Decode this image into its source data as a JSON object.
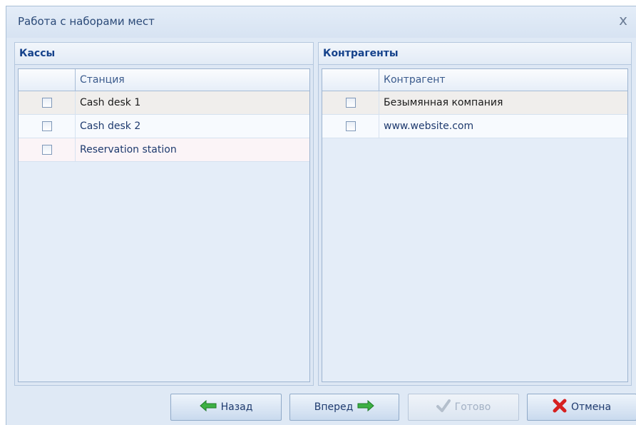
{
  "window": {
    "title": "Работа с наборами мест",
    "close_label": "x"
  },
  "left_pane": {
    "header": "Кассы",
    "column_header": "Станция",
    "rows": [
      {
        "label": "Cash desk 1",
        "checked": false
      },
      {
        "label": "Cash desk 2",
        "checked": false
      },
      {
        "label": "Reservation station",
        "checked": false
      }
    ]
  },
  "right_pane": {
    "header": "Контрагенты",
    "column_header": "Контрагент",
    "rows": [
      {
        "label": "Безымянная компания",
        "checked": false
      },
      {
        "label": "www.website.com",
        "checked": false
      }
    ]
  },
  "buttons": {
    "back": "Назад",
    "next": "Вперед",
    "done": "Готово",
    "cancel": "Отмена"
  },
  "icons": {
    "back": "arrow-left-icon",
    "next": "arrow-right-icon",
    "done": "checkmark-icon",
    "cancel": "red-x-icon"
  },
  "colors": {
    "arrow_green": "#3cb043",
    "cancel_red": "#d62020",
    "header_text": "#15428b"
  }
}
